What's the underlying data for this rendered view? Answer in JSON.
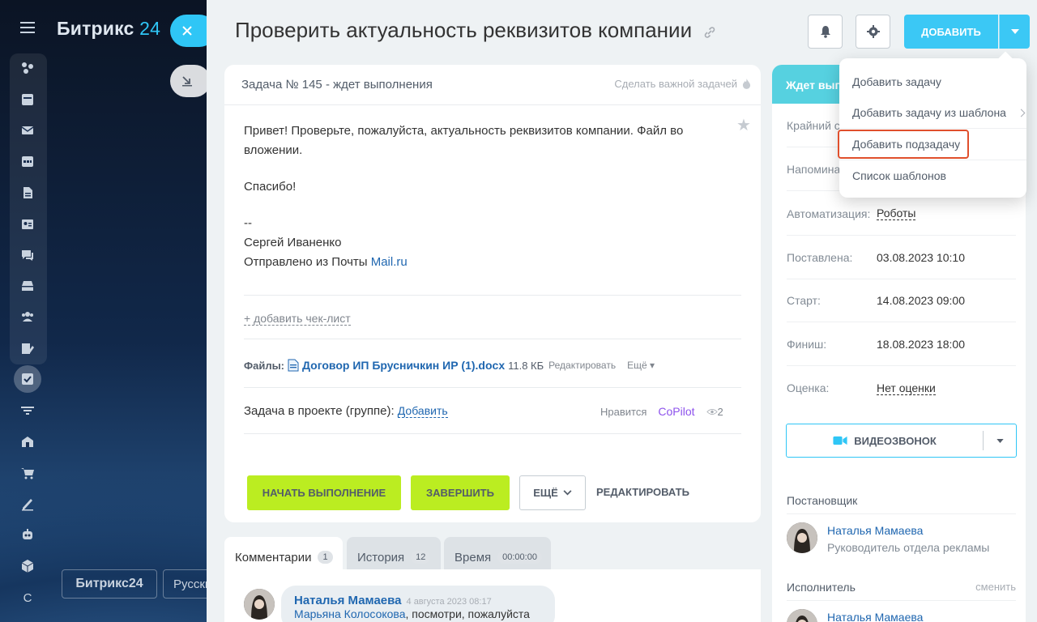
{
  "portal": {
    "logo_text": "Битрикс",
    "logo_num": "24",
    "footer_logo": "Битрикс24",
    "footer_lang": "Русский"
  },
  "leftnav": {
    "items": [
      "widgets-icon",
      "calendar-grid-icon",
      "mail-icon",
      "calendar-icon",
      "document-icon",
      "contact-card-icon",
      "chat-icon",
      "inbox-icon",
      "group-icon",
      "edit-list-icon",
      "tasks-icon",
      "filter-icon",
      "building-icon",
      "cart-icon",
      "sign-icon",
      "robot-icon",
      "box-icon"
    ],
    "letter": "C"
  },
  "task": {
    "title": "Проверить актуальность реквизитов компании",
    "header": "Задача № 145 - ждет выполнения",
    "make_important": "Сделать важной задачей",
    "desc": {
      "line1": "Привет! Проверьте, пожалуйста, актуальность реквизитов компании. Файл во вложении.",
      "line2": "Спасибо!",
      "line3": "--",
      "line4": "Сергей Иваненко",
      "line5_pre": "Отправлено из Почты ",
      "line5_link": "Mail.ru"
    },
    "add_checklist": "+ добавить чек-лист",
    "files_label": "Файлы:",
    "file_name": "Договор ИП Брусничкин ИР (1).docx",
    "file_size": "11.8 КБ",
    "file_edit": "Редактировать",
    "file_more": "Ещё",
    "project_label": "Задача в проекте (группе):",
    "project_add": "Добавить",
    "likes": "Нравится",
    "copilot": "CoPilot",
    "views": "2",
    "btn_start": "НАЧАТЬ ВЫПОЛНЕНИЕ",
    "btn_done": "ЗАВЕРШИТЬ",
    "btn_more": "ЕЩЁ",
    "btn_edit": "РЕДАКТИРОВАТЬ"
  },
  "toolbar": {
    "add_label": "ДОБАВИТЬ"
  },
  "tabs": [
    {
      "label": "Комментарии",
      "count": "1"
    },
    {
      "label": "История",
      "count": "12"
    },
    {
      "label": "Время",
      "count": "00:00:00"
    }
  ],
  "comment": {
    "author": "Наталья Мамаева",
    "date": "4 августа 2023 08:17",
    "mention": "Марьяна Колосокова",
    "text": ", посмотри, пожалуйста"
  },
  "side": {
    "status": "Ждет выполнения",
    "deadline_label": "Крайний срок:",
    "reminder_label": "Напоминание:",
    "automation_label": "Автоматизация:",
    "automation_value": "Роботы",
    "created_label": "Поставлена:",
    "created_value": "03.08.2023 10:10",
    "start_label": "Старт:",
    "start_value": "14.08.2023 09:00",
    "finish_label": "Финиш:",
    "finish_value": "18.08.2023 18:00",
    "rating_label": "Оценка:",
    "rating_value": "Нет оценки",
    "video": "ВИДЕОЗВОНОК",
    "creator_title": "Постановщик",
    "creator_name": "Наталья Мамаева",
    "creator_pos": "Руководитель отдела рекламы",
    "assignee_title": "Исполнитель",
    "assignee_change": "сменить",
    "assignee_name": "Наталья Мамаева"
  },
  "menu": {
    "items": [
      "Добавить задачу",
      "Добавить задачу из шаблона",
      "Добавить подзадачу",
      "Список шаблонов"
    ],
    "highlighted": "Добавить подзадачу"
  },
  "colors": {
    "accent": "#3bc8f5",
    "green": "#bbed21",
    "highlight": "#e04f2c",
    "status": "#56d1e0"
  }
}
